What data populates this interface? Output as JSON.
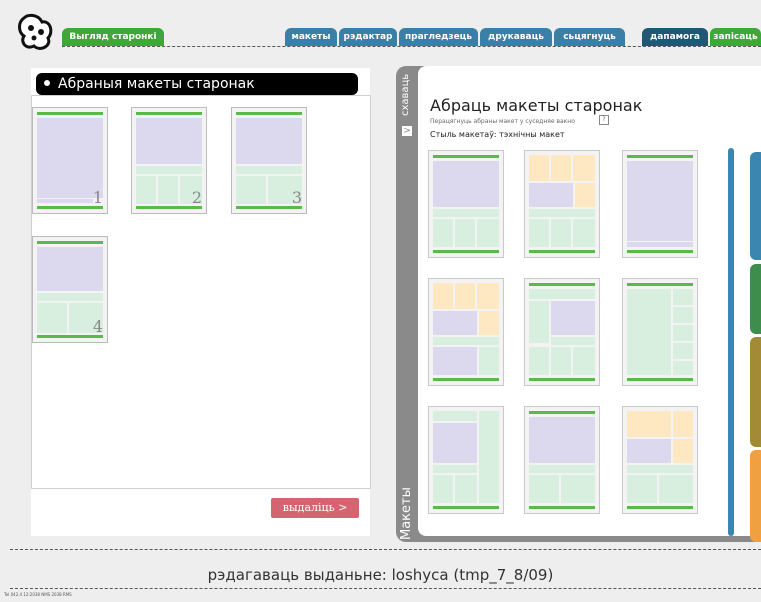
{
  "header": {
    "view_tab": "Выгляд старонкі",
    "tabs": [
      "макеты",
      "рэдактар",
      "прагледзець",
      "друкаваць",
      "сьцягнуць"
    ],
    "help_tab": "дапамога",
    "save_tab": "запісаць"
  },
  "left_panel": {
    "title": "Абраныя макеты старонак",
    "thumbnails": [
      "1",
      "2",
      "3",
      "4"
    ],
    "select_button": "выдаліць >"
  },
  "right_panel": {
    "hide_tab": "схаваць",
    "hide_arrow": ">",
    "makety_tab": "Макеты",
    "title": "Абраць макеты старонак",
    "subtitle": "Перацягнуць абраны макет у суседняе вакно",
    "style_label": "Стыль макетаў: тэхнічны макет"
  },
  "footer": {
    "status": "рэдагаваць выданьне: loshyca (tmp_7_8/09)",
    "tiny_text": "Tel 042.4 12:2038 NMS 2038 RMS"
  },
  "colors": {
    "green": "#3fa63c",
    "blue": "#3a7fa5",
    "dark_blue": "#1f5874",
    "delete_button": "#d36470"
  }
}
